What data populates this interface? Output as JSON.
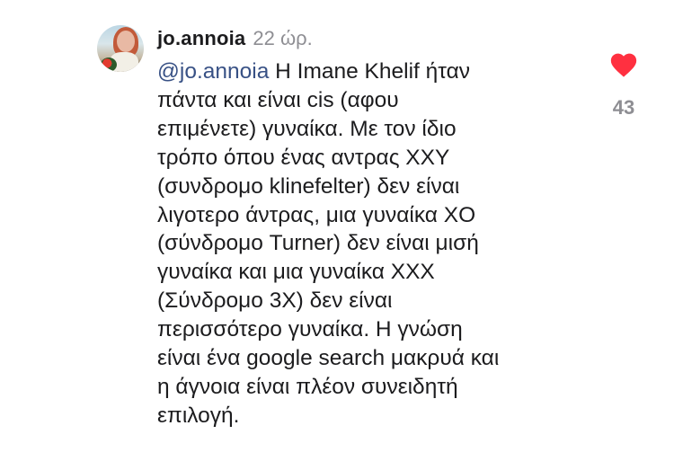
{
  "comment": {
    "username": "jo.annoia",
    "timestamp": "22 ώρ.",
    "mention": "@jo.annoia",
    "first_line_rest": " Η Imane Khelif ήταν",
    "lines": [
      "πάντα και είναι cis (αφου",
      "επιμένετε) γυναίκα. Με τον ίδιο",
      "τρόπο όπου ένας αντρας XXY",
      "(συνδρομο klinefelter) δεν είναι",
      "λιγοτερο άντρας, μια γυναίκα XO",
      "(σύνδρομο Turner) δεν είναι μισή",
      "γυναίκα και μια γυναίκα XXX",
      "(Σύνδρομο 3X) δεν είναι",
      "περισσότερο γυναίκα. Η γνώση",
      "είναι ένα google search μακρυά και",
      "η άγνοια είναι πλέον συνειδητή",
      "επιλογή."
    ],
    "like_count": "43",
    "heart_icon": "heart-filled-icon",
    "colors": {
      "heart": "#ff3040",
      "mention": "#385185",
      "secondary_text": "#8e8e93"
    }
  }
}
